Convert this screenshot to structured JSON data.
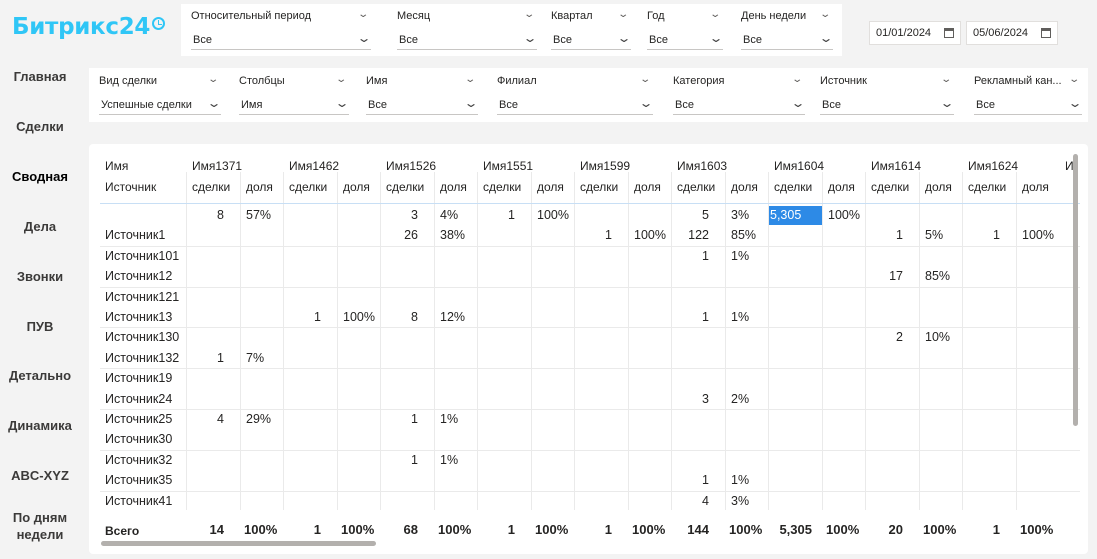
{
  "logo": "Битрикс24",
  "top_filters": [
    {
      "label": "Относительный период",
      "value": "Все"
    },
    {
      "label": "Месяц",
      "value": "Все"
    },
    {
      "label": "Квартал",
      "value": "Все"
    },
    {
      "label": "Год",
      "value": "Все"
    },
    {
      "label": "День недели",
      "value": "Все"
    }
  ],
  "dates": {
    "from": "01/01/2024",
    "to": "05/06/2024"
  },
  "second_filters": [
    {
      "label": "Вид сделки",
      "value": "Успешные сделки"
    },
    {
      "label": "Столбцы",
      "value": "Имя"
    },
    {
      "label": "Имя",
      "value": "Все"
    },
    {
      "label": "Филиал",
      "value": "Все"
    },
    {
      "label": "Категория",
      "value": "Все"
    },
    {
      "label": "Источник",
      "value": "Все"
    },
    {
      "label": "Рекламный кан...",
      "value": "Все"
    }
  ],
  "nav": [
    "Главная",
    "Сделки",
    "Сводная",
    "Дела",
    "Звонки",
    "ПУВ",
    "Детально",
    "Динамика",
    "ABC-XYZ",
    "По дням недели"
  ],
  "active_nav": "Сводная",
  "matrix": {
    "corner_top": "Имя",
    "corner_bottom": "Источник",
    "columns": [
      "Имя1371",
      "Имя1462",
      "Имя1526",
      "Имя1551",
      "Имя1599",
      "Имя1603",
      "Имя1604",
      "Имя1614",
      "Имя1624",
      "И"
    ],
    "sub_cols": [
      "сделки",
      "доля"
    ],
    "rows": [
      {
        "name": "",
        "values": [
          "8",
          "57%",
          "",
          "",
          "3",
          "4%",
          "1",
          "100%",
          "",
          "",
          "5",
          "3%",
          "5,305",
          "100%",
          "",
          "",
          "",
          ""
        ]
      },
      {
        "name": "Источник1",
        "values": [
          "",
          "",
          "",
          "",
          "26",
          "38%",
          "",
          "",
          "1",
          "100%",
          "122",
          "85%",
          "",
          "",
          "1",
          "5%",
          "1",
          "100%"
        ]
      },
      {
        "name": "Источник101",
        "values": [
          "",
          "",
          "",
          "",
          "",
          "",
          "",
          "",
          "",
          "",
          "1",
          "1%",
          "",
          "",
          "",
          "",
          "",
          ""
        ]
      },
      {
        "name": "Источник12",
        "values": [
          "",
          "",
          "",
          "",
          "",
          "",
          "",
          "",
          "",
          "",
          "",
          "",
          "",
          "",
          "17",
          "85%",
          "",
          ""
        ]
      },
      {
        "name": "Источник121",
        "values": [
          "",
          "",
          "",
          "",
          "",
          "",
          "",
          "",
          "",
          "",
          "",
          "",
          "",
          "",
          "",
          "",
          "",
          ""
        ]
      },
      {
        "name": "Источник13",
        "values": [
          "",
          "",
          "1",
          "100%",
          "8",
          "12%",
          "",
          "",
          "",
          "",
          "1",
          "1%",
          "",
          "",
          "",
          "",
          "",
          ""
        ]
      },
      {
        "name": "Источник130",
        "values": [
          "",
          "",
          "",
          "",
          "",
          "",
          "",
          "",
          "",
          "",
          "",
          "",
          "",
          "",
          "2",
          "10%",
          "",
          ""
        ]
      },
      {
        "name": "Источник132",
        "values": [
          "1",
          "7%",
          "",
          "",
          "",
          "",
          "",
          "",
          "",
          "",
          "",
          "",
          "",
          "",
          "",
          "",
          "",
          ""
        ]
      },
      {
        "name": "Источник19",
        "values": [
          "",
          "",
          "",
          "",
          "",
          "",
          "",
          "",
          "",
          "",
          "",
          "",
          "",
          "",
          "",
          "",
          "",
          ""
        ]
      },
      {
        "name": "Источник24",
        "values": [
          "",
          "",
          "",
          "",
          "",
          "",
          "",
          "",
          "",
          "",
          "3",
          "2%",
          "",
          "",
          "",
          "",
          "",
          ""
        ]
      },
      {
        "name": "Источник25",
        "values": [
          "4",
          "29%",
          "",
          "",
          "1",
          "1%",
          "",
          "",
          "",
          "",
          "",
          "",
          "",
          "",
          "",
          "",
          "",
          ""
        ]
      },
      {
        "name": "Источник30",
        "values": [
          "",
          "",
          "",
          "",
          "",
          "",
          "",
          "",
          "",
          "",
          "",
          "",
          "",
          "",
          "",
          "",
          "",
          ""
        ]
      },
      {
        "name": "Источник32",
        "values": [
          "",
          "",
          "",
          "",
          "1",
          "1%",
          "",
          "",
          "",
          "",
          "",
          "",
          "",
          "",
          "",
          "",
          "",
          ""
        ]
      },
      {
        "name": "Источник35",
        "values": [
          "",
          "",
          "",
          "",
          "",
          "",
          "",
          "",
          "",
          "",
          "1",
          "1%",
          "",
          "",
          "",
          "",
          "",
          ""
        ]
      },
      {
        "name": "Источник41",
        "values": [
          "",
          "",
          "",
          "",
          "",
          "",
          "",
          "",
          "",
          "",
          "4",
          "3%",
          "",
          "",
          "",
          "",
          "",
          ""
        ]
      }
    ],
    "total_label": "Всего",
    "totals": [
      "14",
      "100%",
      "1",
      "100%",
      "68",
      "100%",
      "1",
      "100%",
      "1",
      "100%",
      "144",
      "100%",
      "5,305",
      "100%",
      "20",
      "100%",
      "1",
      "100%"
    ]
  },
  "colors": {
    "brand": "#2fc6f6",
    "highlight": "#2d8ae6"
  }
}
